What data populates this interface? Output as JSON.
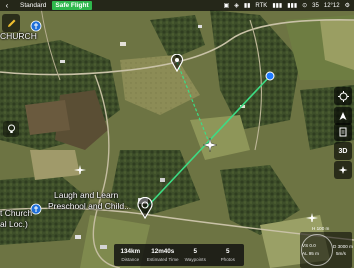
{
  "topbar": {
    "back_glyph": "‹",
    "mode": "Standard",
    "flight_status": "Safe Flight",
    "status_items": [
      "▣",
      "◈",
      "▮▮",
      "RTK",
      "▮▮▮",
      "▮▮▮",
      "⊙"
    ],
    "gps": "35",
    "time": "12°12",
    "settings_glyph": "⚙"
  },
  "map_labels": {
    "church_top": "CHURCH",
    "place_name_line1": "Laugh and Learn",
    "place_name_line2": "Preschool and Child...",
    "church_bottom_line1": "t Church",
    "church_bottom_line2": "al Loc.)"
  },
  "stats": [
    {
      "value": "134km",
      "label": "Distance"
    },
    {
      "value": "12m40s",
      "label": "Estimated Time"
    },
    {
      "value": "5",
      "label": "Waypoints"
    },
    {
      "value": "5",
      "label": "Photos"
    }
  ],
  "telemetry": {
    "dist": "D  3000 m",
    "speed_h": "5m/s",
    "vs": "VS  0.0",
    "alt": "AL  95 m",
    "hd": "H 100 m"
  },
  "right_controls": {
    "three_d": "3D"
  },
  "colors": {
    "flight_badge": "#2fb84d",
    "route": "#3ddc84",
    "waypoint": "#1e7bff"
  }
}
